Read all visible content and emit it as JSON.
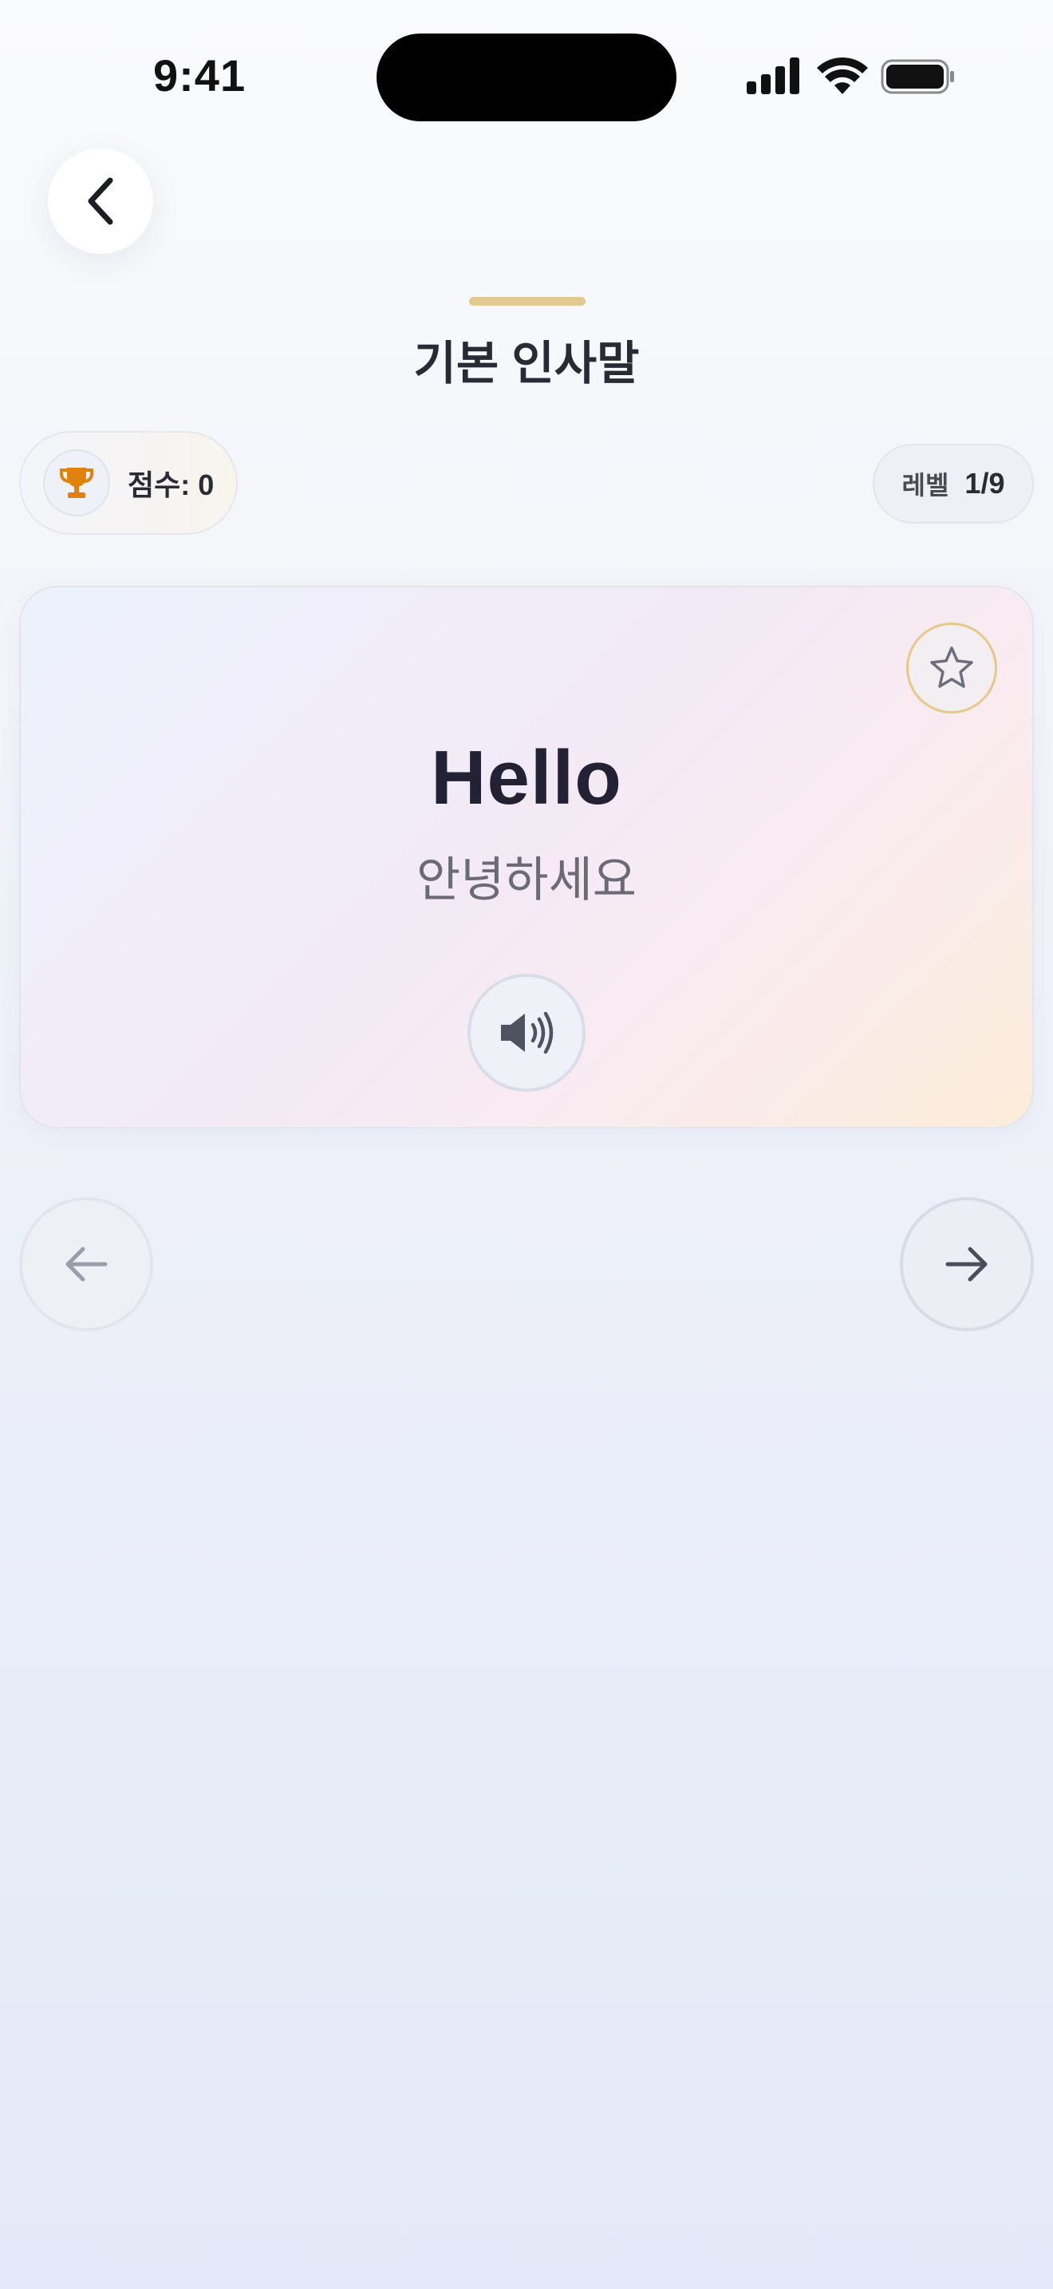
{
  "status_bar": {
    "time": "9:41"
  },
  "header": {
    "title": "기본 인사말",
    "accent_color": "#e2c98f"
  },
  "stats": {
    "score_label": "점수: 0",
    "level_label": "레벨",
    "level_value": "1/9",
    "trophy_color": "#e0820c"
  },
  "flashcard": {
    "word": "Hello",
    "translation": "안녕하세요",
    "favorite_icon": "star-icon",
    "audio_icon": "speaker-icon"
  },
  "navigation": {
    "prev_icon": "arrow-left-icon",
    "next_icon": "arrow-right-icon"
  }
}
